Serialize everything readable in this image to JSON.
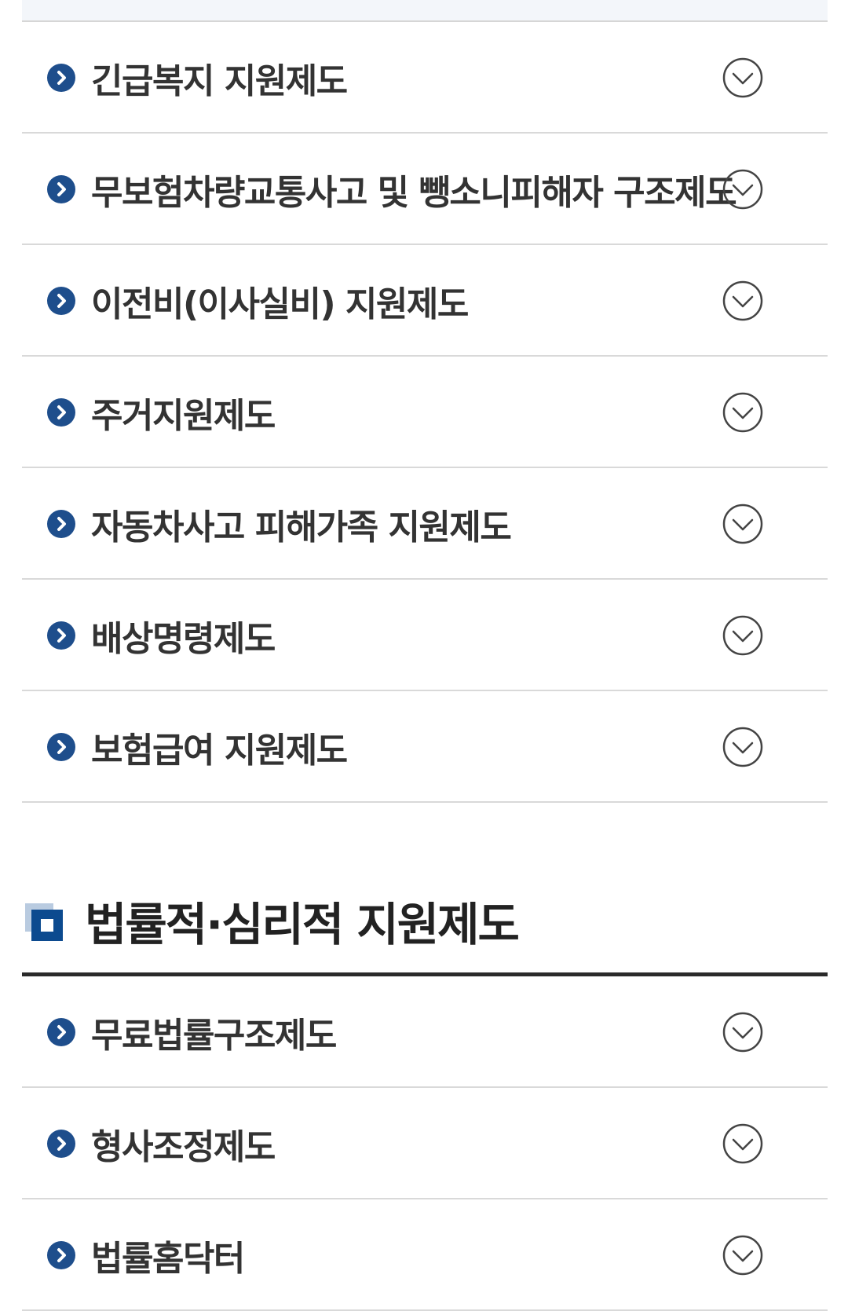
{
  "colors": {
    "bullet": "#1e4e8c",
    "text": "#333333",
    "divider": "#d9d9d9",
    "section_rule": "#2a2a2a",
    "section_icon_dark": "#0c4a8f",
    "section_icon_light": "#b9cbe0"
  },
  "icons": {
    "item_bullet": "chevron-right-circle-icon",
    "expand": "circle-chevron-down-icon",
    "section": "square-section-icon"
  },
  "support_list": [
    {
      "label": "긴급복지 지원제도"
    },
    {
      "label": "무보험차량교통사고 및 뺑소니피해자 구조제도"
    },
    {
      "label": "이전비(이사실비) 지원제도"
    },
    {
      "label": "주거지원제도"
    },
    {
      "label": "자동차사고 피해가족 지원제도"
    },
    {
      "label": "배상명령제도"
    },
    {
      "label": "보험급여 지원제도"
    }
  ],
  "legal_section": {
    "title": "법률적·심리적 지원제도",
    "items": [
      {
        "label": "무료법률구조제도"
      },
      {
        "label": "형사조정제도"
      },
      {
        "label": "법률홈닥터"
      }
    ]
  }
}
